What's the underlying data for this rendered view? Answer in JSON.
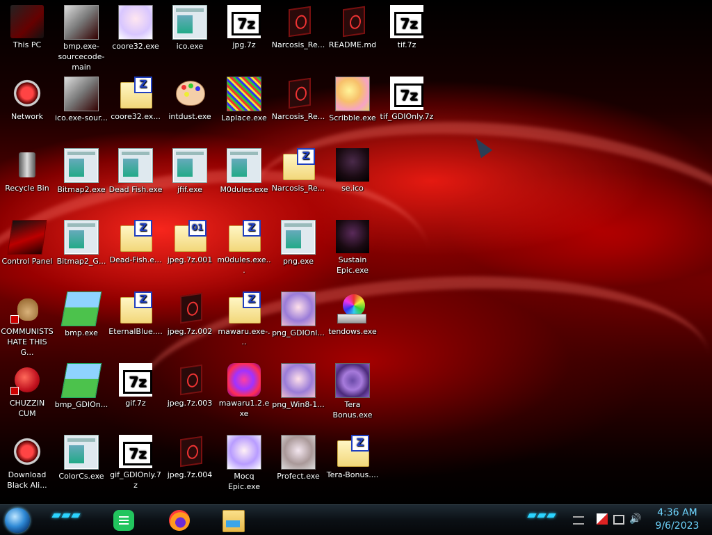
{
  "desktop": {
    "col1": {
      "this_pc": "This PC",
      "network": "Network",
      "recycle_bin": "Recycle Bin",
      "control_panel": "Control Panel",
      "communists": "COMMUNISTS HATE THIS G...",
      "chuzzin": "CHUZZIN CUM",
      "download": "Download Black Ali..."
    },
    "col2": {
      "bmp_src": "bmp.exe-sourcecode-main",
      "ico_src": "ico.exe-sour...",
      "bitmap2": "Bitmap2.exe",
      "bitmap2g": "Bitmap2_G...",
      "bmp": "bmp.exe",
      "bmp_gdi": "bmp_GDIOn...",
      "colorcs": "ColorCs.exe"
    },
    "col3": {
      "coore32": "coore32.exe",
      "coore32e": "coore32.ex...",
      "deadfish": "Dead Fish.exe",
      "deadfishe": "Dead-Fish.e...",
      "eternal": "EternalBlue....",
      "gif": "gif.7z",
      "gif_gdi": "gif_GDIOnly.7z"
    },
    "col4": {
      "ico": "ico.exe",
      "intdust": "intdust.exe",
      "jfif": "jfif.exe",
      "jpeg001": "jpeg.7z.001",
      "jpeg002": "jpeg.7z.002",
      "jpeg003": "jpeg.7z.003",
      "jpeg004": "jpeg.7z.004"
    },
    "col5": {
      "jpg": "jpg.7z",
      "laplace": "Laplace.exe",
      "m0dules": "M0dules.exe",
      "m0dulese": "m0dules.exe...",
      "mawaru": "mawaru.exe-...",
      "mawaru12": "mawaru1.2.exe",
      "mocq": "Mocq Epic.exe"
    },
    "col6": {
      "narc1": "Narcosis_Re...",
      "narc2": "Narcosis_Re...",
      "narc3": "Narcosis_Re...",
      "png": "png.exe",
      "png_gdi": "png_GDIOnl...",
      "png_win8": "png_Win8-1...",
      "profect": "Profect.exe"
    },
    "col7": {
      "readme": "README.md",
      "scribble": "Scribble.exe",
      "se_ico": "se.ico",
      "sustain": "Sustain Epic.exe",
      "tendows": "tendows.exe",
      "tera": "Tera Bonus.exe",
      "tera_z": "Tera-Bonus...."
    },
    "col8": {
      "tif": "tif.7z",
      "tif_gdi": "tif_GDIOnly.7z"
    }
  },
  "badges": {
    "zip": "Z",
    "split": "01",
    "sevenzip": "7z"
  },
  "taskbar": {
    "time": "4:36 AM",
    "date": "9/6/2023",
    "accent": "#2bd4ff"
  }
}
